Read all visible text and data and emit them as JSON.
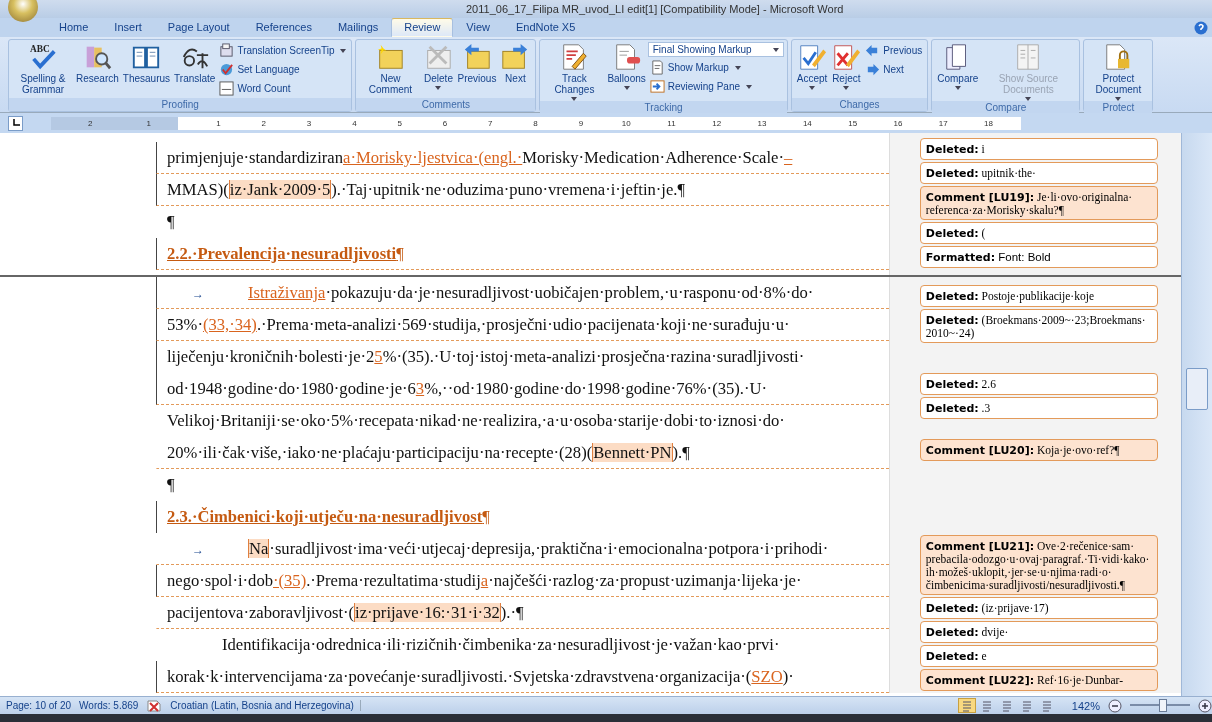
{
  "window": {
    "title": "2011_06_17_Filipa MR_uvod_LI edit[1] [Compatibility Mode] - Microsoft Word"
  },
  "tabs": [
    {
      "label": "Home",
      "selected": false
    },
    {
      "label": "Insert",
      "selected": false
    },
    {
      "label": "Page Layout",
      "selected": false
    },
    {
      "label": "References",
      "selected": false
    },
    {
      "label": "Mailings",
      "selected": false
    },
    {
      "label": "Review",
      "selected": true
    },
    {
      "label": "View",
      "selected": false
    },
    {
      "label": "EndNote X5",
      "selected": false
    }
  ],
  "ribbon": [
    {
      "name": "Proofing",
      "buttons": [
        {
          "kind": "large",
          "label": "Spelling & Grammar",
          "icon_text": "ABC",
          "has_menu": false,
          "disabled": false
        },
        {
          "kind": "large",
          "label": "Research",
          "has_menu": false,
          "disabled": false
        },
        {
          "kind": "large",
          "label": "Thesaurus",
          "has_menu": false,
          "disabled": false
        },
        {
          "kind": "large",
          "label": "Translate",
          "has_menu": false,
          "disabled": false
        },
        {
          "kind": "small",
          "label": "Translation ScreenTip",
          "has_menu": true,
          "disabled": false
        },
        {
          "kind": "small",
          "label": "Set Language",
          "has_menu": false,
          "disabled": false
        },
        {
          "kind": "small",
          "label": "Word Count",
          "has_menu": false,
          "disabled": false
        }
      ]
    },
    {
      "name": "Comments",
      "buttons": [
        {
          "kind": "large",
          "label": "New Comment",
          "has_menu": false,
          "disabled": false
        },
        {
          "kind": "large",
          "label": "Delete",
          "has_menu": true,
          "disabled": false
        },
        {
          "kind": "large",
          "label": "Previous",
          "has_menu": false,
          "disabled": false
        },
        {
          "kind": "large",
          "label": "Next",
          "has_menu": false,
          "disabled": false
        }
      ]
    },
    {
      "name": "Tracking",
      "buttons": [
        {
          "kind": "large",
          "label": "Track Changes",
          "has_menu": true,
          "disabled": false
        },
        {
          "kind": "large",
          "label": "Balloons",
          "has_menu": true,
          "disabled": false
        },
        {
          "kind": "dropdown",
          "label": "Final Showing Markup",
          "has_menu": true,
          "disabled": false
        },
        {
          "kind": "small",
          "label": "Show Markup",
          "has_menu": true,
          "disabled": false
        },
        {
          "kind": "small",
          "label": "Reviewing Pane",
          "has_menu": true,
          "disabled": false
        }
      ]
    },
    {
      "name": "Changes",
      "buttons": [
        {
          "kind": "large",
          "label": "Accept",
          "has_menu": true,
          "disabled": false
        },
        {
          "kind": "large",
          "label": "Reject",
          "has_menu": true,
          "disabled": false
        },
        {
          "kind": "small",
          "label": "Previous",
          "has_menu": false,
          "disabled": false
        },
        {
          "kind": "small",
          "label": "Next",
          "has_menu": false,
          "disabled": false
        }
      ]
    },
    {
      "name": "Compare",
      "buttons": [
        {
          "kind": "large",
          "label": "Compare",
          "has_menu": true,
          "disabled": false
        },
        {
          "kind": "large",
          "label": "Show Source Documents",
          "has_menu": true,
          "disabled": true
        }
      ]
    },
    {
      "name": "Protect",
      "buttons": [
        {
          "kind": "large",
          "label": "Protect Document",
          "has_menu": true,
          "disabled": false
        }
      ]
    }
  ],
  "ruler": {
    "left_numbers": [
      "2",
      "1"
    ],
    "numbers": [
      "1",
      "2",
      "3",
      "4",
      "5",
      "6",
      "7",
      "8",
      "9",
      "10",
      "11",
      "12",
      "13",
      "14",
      "15",
      "16",
      "17",
      "18"
    ]
  },
  "pages": [
    {
      "lines": [
        {
          "kind": "body",
          "changed": true,
          "linked": true,
          "segments": [
            {
              "kind": "plain",
              "t": "primjenjuje·standardiziran"
            },
            {
              "kind": "inserted",
              "t": "a·Morisky·ljestvica·(engl.·"
            },
            {
              "kind": "plain",
              "t": "Morisky·Medication·Adherence·Scale·"
            },
            {
              "kind": "inserted",
              "t": "–"
            }
          ]
        },
        {
          "kind": "body",
          "changed": true,
          "linked": true,
          "segments": [
            {
              "kind": "plain",
              "t": "MMAS)("
            },
            {
              "kind": "commented",
              "t": "iz·Jank·2009·5"
            },
            {
              "kind": "plain",
              "t": ").·Taj·upitnik·ne·oduzima·puno·vremena·i·jeftin·je.¶"
            }
          ]
        },
        {
          "kind": "body",
          "changed": false,
          "linked": false,
          "segments": [
            {
              "kind": "plain",
              "t": "¶"
            }
          ]
        },
        {
          "kind": "heading",
          "changed": true,
          "linked": true,
          "segments": [
            {
              "kind": "plain",
              "t": "2.2.·Prevalencija·nesuradljivosti"
            },
            {
              "kind": "mark",
              "t": "¶"
            }
          ]
        }
      ],
      "balloons": [
        {
          "kind": "deleted",
          "label": "Deleted:",
          "text": "i"
        },
        {
          "kind": "deleted",
          "label": "Deleted:",
          "text": "upitnik·the·"
        },
        {
          "kind": "comment",
          "label": "Comment [LU19]:",
          "text": "Je·li·ovo·originalna·referenca·za·Morisky·skalu?¶"
        },
        {
          "kind": "deleted",
          "label": "Deleted:",
          "text": "("
        },
        {
          "kind": "formatted",
          "label": "Formatted:",
          "text": "Font: Bold"
        }
      ]
    },
    {
      "lines": [
        {
          "kind": "body",
          "changed": true,
          "linked": true,
          "segments": [
            {
              "kind": "tab",
              "t": "→"
            },
            {
              "kind": "inserted",
              "t": "Istraživanja"
            },
            {
              "kind": "plain",
              "t": "·pokazuju·da·je·nesuradljivost·uobičajen·problem,·u·rasponu·od·8%·do·"
            }
          ]
        },
        {
          "kind": "body",
          "changed": true,
          "linked": true,
          "segments": [
            {
              "kind": "plain",
              "t": "53%·"
            },
            {
              "kind": "inserted",
              "t": "(33,·34)"
            },
            {
              "kind": "plain",
              "t": ".·Prema·meta-analizi·569·studija,·prosječni·udio·pacijenata·koji·ne·surađuju·u·"
            }
          ]
        },
        {
          "kind": "body",
          "changed": true,
          "linked": false,
          "segments": [
            {
              "kind": "plain",
              "t": "liječenju·kroničnih·bolesti·je·2"
            },
            {
              "kind": "inserted",
              "t": "5"
            },
            {
              "kind": "plain",
              "t": "%·(35).·U·toj·istoj·meta-analizi·prosječna·razina·suradljivosti·"
            }
          ]
        },
        {
          "kind": "body",
          "changed": true,
          "linked": true,
          "segments": [
            {
              "kind": "plain",
              "t": "od·1948·godine·do·1980·godine·je·6"
            },
            {
              "kind": "inserted",
              "t": "3"
            },
            {
              "kind": "plain",
              "t": "%,··od·1980·godine·do·1998·godine·76%·(35).·U·"
            }
          ]
        },
        {
          "kind": "body",
          "changed": false,
          "linked": false,
          "segments": [
            {
              "kind": "plain",
              "t": "Velikoj·Britaniji·se·oko·5%·recepata·nikad·ne·realizira,·a·u·osoba·starije·dobi·to·iznosi·do·"
            }
          ]
        },
        {
          "kind": "body",
          "changed": false,
          "linked": true,
          "segments": [
            {
              "kind": "plain",
              "t": "20%·ili·čak·više,·iako·ne·plaćaju·participaciju·na·recepte·(28)("
            },
            {
              "kind": "commented",
              "t": "Bennett·PN"
            },
            {
              "kind": "plain",
              "t": ").¶"
            }
          ]
        },
        {
          "kind": "body",
          "changed": false,
          "linked": false,
          "segments": [
            {
              "kind": "plain",
              "t": "¶"
            }
          ]
        },
        {
          "kind": "heading",
          "changed": true,
          "linked": false,
          "segments": [
            {
              "kind": "plain",
              "t": "2.3.·Čimbenici·koji·utječu·na·nesuradljivost"
            },
            {
              "kind": "mark",
              "t": "¶"
            }
          ]
        },
        {
          "kind": "body",
          "changed": false,
          "linked": true,
          "segments": [
            {
              "kind": "tab",
              "t": "→"
            },
            {
              "kind": "commented",
              "t": "Na"
            },
            {
              "kind": "plain",
              "t": "·suradljivost·ima·veći·utjecaj·depresija,·praktična·i·emocionalna·potpora·i·prihodi·"
            }
          ]
        },
        {
          "kind": "body",
          "changed": true,
          "linked": true,
          "segments": [
            {
              "kind": "plain",
              "t": "nego·spol·i·dob"
            },
            {
              "kind": "inserted",
              "t": "·(35)"
            },
            {
              "kind": "plain",
              "t": ".·Prema·rezultatima·studij"
            },
            {
              "kind": "inserted",
              "t": "a"
            },
            {
              "kind": "plain",
              "t": "·najčešći·razlog·za·propust·uzimanja·lijeka·je·"
            }
          ]
        },
        {
          "kind": "body",
          "changed": false,
          "linked": true,
          "segments": [
            {
              "kind": "plain",
              "t": "pacijentova·zaboravljivost·("
            },
            {
              "kind": "commented",
              "t": "iz·prijave·16:·31·i·32"
            },
            {
              "kind": "plain",
              "t": ").·¶"
            }
          ]
        },
        {
          "kind": "indented",
          "changed": false,
          "linked": false,
          "segments": [
            {
              "kind": "plain",
              "t": "Identifikacija·odrednica·ili·rizičnih·čimbenika·za·nesuradljivost·je·važan·kao·prvi·"
            }
          ]
        },
        {
          "kind": "body",
          "changed": true,
          "linked": true,
          "segments": [
            {
              "kind": "plain",
              "t": "korak·k·intervencijama·za·povećanje·suradljivosti.·Svjetska·zdravstvena·organizacija·("
            },
            {
              "kind": "inserted",
              "t": "SZO"
            },
            {
              "kind": "plain",
              "t": ")·"
            }
          ]
        }
      ],
      "balloons": [
        {
          "kind": "deleted",
          "label": "Deleted:",
          "text": "Postoje·publikacije·koje"
        },
        {
          "kind": "deleted",
          "label": "Deleted:",
          "text": "(Broekmans·2009~·23;Broekmans·2010~·24)"
        },
        {
          "kind": "deleted",
          "label": "Deleted:",
          "text": "2.6"
        },
        {
          "kind": "deleted",
          "label": "Deleted:",
          "text": ".3"
        },
        {
          "kind": "comment",
          "label": "Comment [LU20]:",
          "text": "Koja·je·ovo·ref?¶"
        },
        {
          "kind": "comment",
          "label": "Comment [LU21]:",
          "text": "Ove·2·rečenice·sam·prebacila·odozgo·u·ovaj·paragraf.·Ti·vidi·kako·ih·možeš·uklopit,·jer·se·u·njima·radi·o·čimbenicima·suradljivosti/nesuradljivosti.¶"
        },
        {
          "kind": "deleted",
          "label": "Deleted:",
          "text": "(iz·prijave·17)"
        },
        {
          "kind": "deleted",
          "label": "Deleted:",
          "text": "dvije·"
        },
        {
          "kind": "deleted",
          "label": "Deleted:",
          "text": "e"
        },
        {
          "kind": "comment",
          "label": "Comment [LU22]:",
          "text": "Ref·16·je·Dunbar-"
        }
      ]
    }
  ],
  "status_bar": {
    "page": "Page: 10 of 20",
    "words": "Words: 5.869",
    "language": "Croatian (Latin, Bosnia and Herzegovina)",
    "views": [
      {
        "selected": true
      },
      {
        "selected": false
      },
      {
        "selected": false
      },
      {
        "selected": false
      },
      {
        "selected": false
      }
    ],
    "zoom": "142%",
    "zoom_slider": {
      "level": 0.55
    }
  }
}
